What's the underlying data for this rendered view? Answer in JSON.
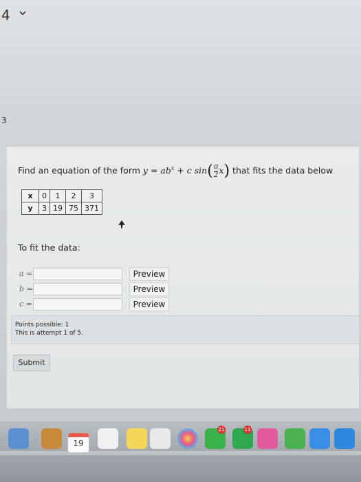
{
  "browser": {
    "tab_indicator": "4",
    "edge_mark": "3"
  },
  "question": {
    "prefix": "Find an equation of the form",
    "equation_lhs": "y = ab",
    "exponent": "x",
    "plus_c_sin": "+ c sin",
    "frac_numerator": "π",
    "frac_denominator": "2",
    "frac_var": "x",
    "suffix": "that fits the data below"
  },
  "table": {
    "x_header": "x",
    "y_header": "y",
    "x_values": [
      "0",
      "1",
      "2",
      "3"
    ],
    "y_values": [
      "3",
      "19",
      "75",
      "371"
    ]
  },
  "fit": {
    "label": "To fit the data:",
    "rows": [
      {
        "label": "a =",
        "value": "",
        "preview": "Preview"
      },
      {
        "label": "b =",
        "value": "",
        "preview": "Preview"
      },
      {
        "label": "c =",
        "value": "",
        "preview": "Preview"
      }
    ]
  },
  "meta": {
    "points_possible": "Points possible: 1",
    "attempt": "This is attempt 1 of 5."
  },
  "actions": {
    "submit": "Submit"
  },
  "dock": {
    "calendar_day": "19",
    "badge_1": "21",
    "badge_2": "11",
    "colors": {
      "accent_red": "#d33333",
      "finder_blue": "#3a8ee6",
      "notes_yellow": "#f3d65a"
    }
  }
}
